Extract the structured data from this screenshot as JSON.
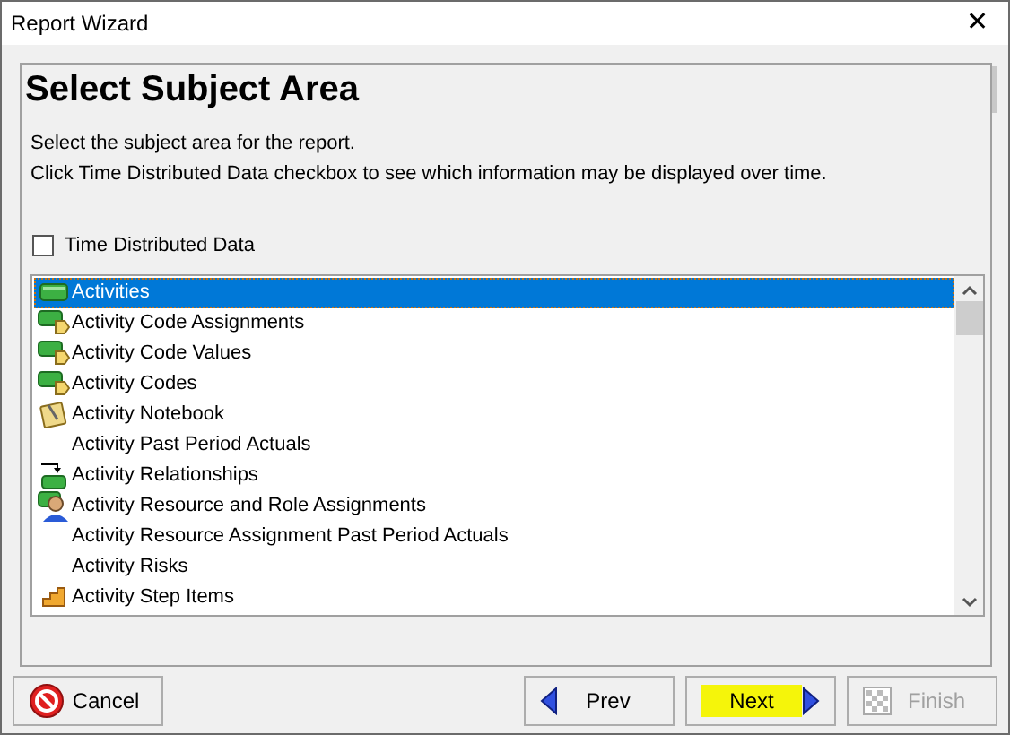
{
  "window": {
    "title": "Report Wizard",
    "close": "✕"
  },
  "heading": "Select Subject Area",
  "instructions": [
    "Select the subject area for the report.",
    "Click Time Distributed Data checkbox to see which information may be displayed over time."
  ],
  "time_distributed": {
    "label": "Time Distributed Data",
    "checked": false
  },
  "subjects": [
    {
      "label": "Activities",
      "kind": "bar",
      "selected": true
    },
    {
      "label": "Activity Code Assignments",
      "kind": "code",
      "selected": false
    },
    {
      "label": "Activity Code Values",
      "kind": "code",
      "selected": false
    },
    {
      "label": "Activity Codes",
      "kind": "code",
      "selected": false
    },
    {
      "label": "Activity Notebook",
      "kind": "notebook",
      "selected": false
    },
    {
      "label": "Activity Past Period Actuals",
      "kind": "none",
      "selected": false
    },
    {
      "label": "Activity Relationships",
      "kind": "relationship",
      "selected": false
    },
    {
      "label": "Activity Resource and Role Assignments",
      "kind": "person",
      "selected": false
    },
    {
      "label": "Activity Resource Assignment Past Period Actuals",
      "kind": "none",
      "selected": false
    },
    {
      "label": "Activity Risks",
      "kind": "none",
      "selected": false
    },
    {
      "label": "Activity Step Items",
      "kind": "step",
      "selected": false
    }
  ],
  "buttons": [
    {
      "label": "Cancel",
      "kind": "cancel",
      "disabled": false,
      "highlighted": false
    },
    {
      "label": "Prev",
      "kind": "prev",
      "disabled": false,
      "highlighted": false
    },
    {
      "label": "Next",
      "kind": "next",
      "disabled": false,
      "highlighted": true
    },
    {
      "label": "Finish",
      "kind": "finish",
      "disabled": true,
      "highlighted": false
    }
  ]
}
